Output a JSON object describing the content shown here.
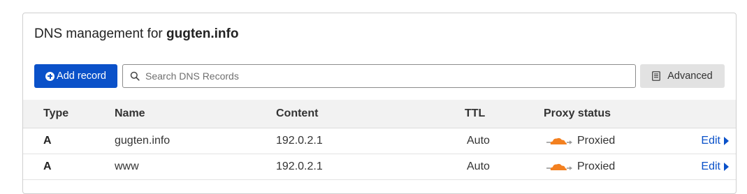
{
  "header": {
    "title_prefix": "DNS management for ",
    "domain": "gugten.info"
  },
  "toolbar": {
    "add_label": "Add record",
    "search_placeholder": "Search DNS Records",
    "search_value": "",
    "advanced_label": "Advanced"
  },
  "table": {
    "columns": [
      "Type",
      "Name",
      "Content",
      "TTL",
      "Proxy status"
    ],
    "rows": [
      {
        "type": "A",
        "name": "gugten.info",
        "content": "192.0.2.1",
        "ttl": "Auto",
        "proxy": "Proxied",
        "edit": "Edit"
      },
      {
        "type": "A",
        "name": "www",
        "content": "192.0.2.1",
        "ttl": "Auto",
        "proxy": "Proxied",
        "edit": "Edit"
      }
    ]
  },
  "colors": {
    "primary": "#0a51c9",
    "proxied_cloud": "#f38020",
    "header_bg": "#f2f2f2"
  },
  "icons": [
    "plus-circle-icon",
    "search-icon",
    "document-icon",
    "cloud-proxied-icon",
    "caret-right-icon"
  ]
}
